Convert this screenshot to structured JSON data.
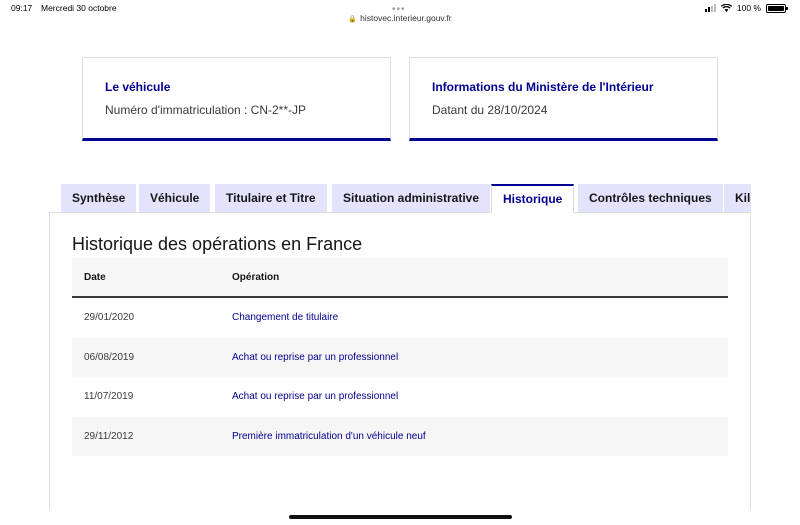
{
  "status_bar": {
    "time": "09:17",
    "date": "Mercredi 30 octobre",
    "battery": "100 %"
  },
  "browser": {
    "more": "•••",
    "url": "histovec.interieur.gouv.fr"
  },
  "cards": {
    "vehicle": {
      "title": "Le véhicule",
      "text": "Numéro d'immatriculation : CN-2**-JP"
    },
    "ministry": {
      "title": "Informations du Ministère de l'Intérieur",
      "text": "Datant du 28/10/2024"
    }
  },
  "tabs": [
    {
      "label": "Synthèse",
      "active": false
    },
    {
      "label": "Véhicule",
      "active": false
    },
    {
      "label": "Titulaire et Titre",
      "active": false
    },
    {
      "label": "Situation administrative",
      "active": false
    },
    {
      "label": "Historique",
      "active": true
    },
    {
      "label": "Contrôles techniques",
      "active": false
    },
    {
      "label": "Kilo",
      "active": false
    }
  ],
  "history": {
    "title": "Historique des opérations en France",
    "columns": [
      "Date",
      "Opération"
    ],
    "rows": [
      {
        "date": "29/01/2020",
        "operation": "Changement de titulaire"
      },
      {
        "date": "06/08/2019",
        "operation": "Achat ou reprise par un professionnel"
      },
      {
        "date": "11/07/2019",
        "operation": "Achat ou reprise par un professionnel"
      },
      {
        "date": "29/11/2012",
        "operation": "Première immatriculation d'un véhicule neuf"
      }
    ]
  },
  "colors": {
    "accent": "#000091",
    "tab_bg": "#e3e3fd",
    "row_alt": "#f6f6f6"
  }
}
